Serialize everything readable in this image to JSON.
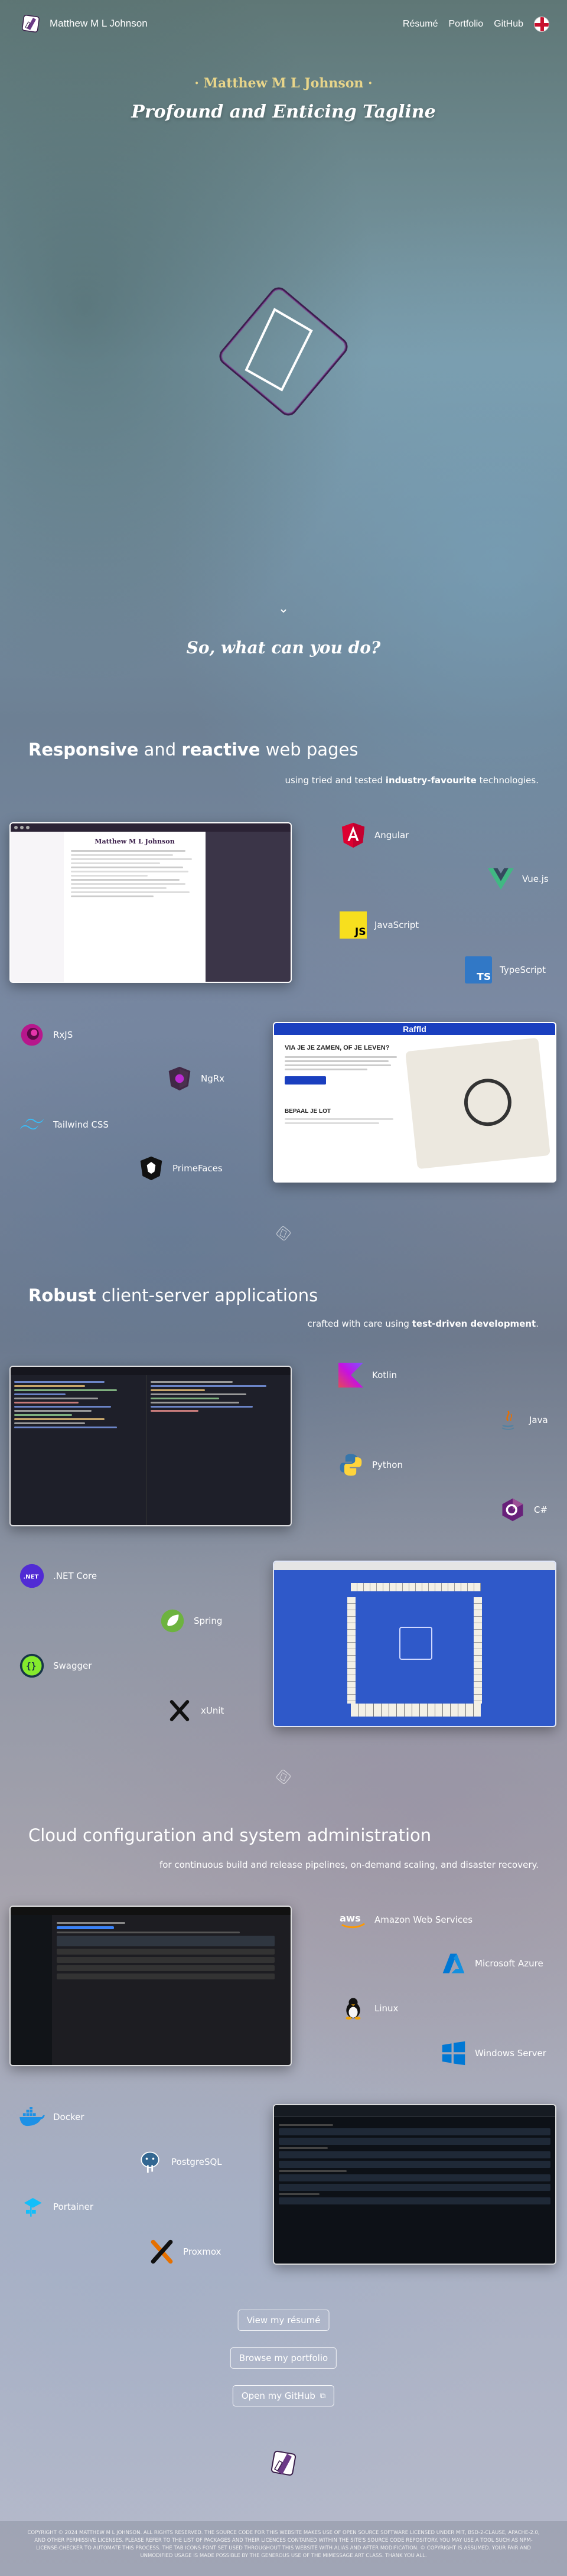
{
  "nav": {
    "brand": "Matthew M L Johnson",
    "links": [
      "Résumé",
      "Portfolio",
      "GitHub"
    ]
  },
  "hero": {
    "name": "· Matthew M L Johnson ·",
    "tagline": "Profound and Enticing Tagline",
    "question": "So, what can you do?"
  },
  "sections": [
    {
      "title_parts": [
        "Responsive",
        " and ",
        "reactive",
        " web pages"
      ],
      "subtitle_parts": [
        "using tried and tested ",
        "industry-favourite",
        " technologies."
      ],
      "tech": [
        "Angular",
        "Vue.js",
        "JavaScript",
        "TypeScript",
        "RxJS",
        "NgRx",
        "Tailwind CSS",
        "PrimeFaces"
      ]
    },
    {
      "title_parts": [
        "Robust",
        " client-server applications"
      ],
      "subtitle_parts": [
        "crafted with care using ",
        "test-driven development",
        "."
      ],
      "tech": [
        "Kotlin",
        "Java",
        "Python",
        "C#",
        ".NET Core",
        "Spring",
        "Swagger",
        "xUnit"
      ]
    },
    {
      "title_parts": [
        "Cloud configuration and system administration"
      ],
      "subtitle_parts": [
        "for continuous build and release pipelines, on-demand scaling, and disaster recovery."
      ],
      "tech": [
        "Amazon Web Services",
        "Microsoft Azure",
        "Linux",
        "Windows Server",
        "Docker",
        "PostgreSQL",
        "Portainer",
        "Proxmox"
      ]
    }
  ],
  "shots": {
    "resume_name": "Matthew M L Johnson",
    "raffld_brand": "Raffld",
    "raffld_headline": "VIA JE JE ZAMEN, OF JE LEVEN?",
    "raffld_sub": "BEPAAL JE LOT"
  },
  "buttons": {
    "resume": "View my résumé",
    "portfolio": "Browse my portfolio",
    "github": "Open my GitHub"
  },
  "copyright": "COPYRIGHT © 2024 MATTHEW M L JOHNSON. ALL RIGHTS RESERVED. THE SOURCE CODE FOR THIS WEBSITE MAKES USE OF OPEN SOURCE SOFTWARE LICENSED UNDER MIT, BSD-2-CLAUSE, APACHE-2.0, AND OTHER PERMISSIVE LICENSES. PLEASE REFER TO THE LIST OF PACKAGES AND THEIR LICENCES CONTAINED WITHIN THE SITE'S SOURCE CODE REPOSITORY. YOU MAY USE A TOOL SUCH AS NPM-LICENSE-CHECKER TO AUTOMATE THIS PROCESS. THE TAB ICONS FONT SET USED THROUGHOUT THIS WEBSITE WITH ALIAS AND AFTER MODIFICATION. © COPYRIGHT IS ASSUMED. YOUR FAIR AND UNMODIFIED USAGE IS MADE POSSIBLE BY THE GENEROUS USE OF THE MIMESSAGE ART CLASS. THANK YOU ALL."
}
